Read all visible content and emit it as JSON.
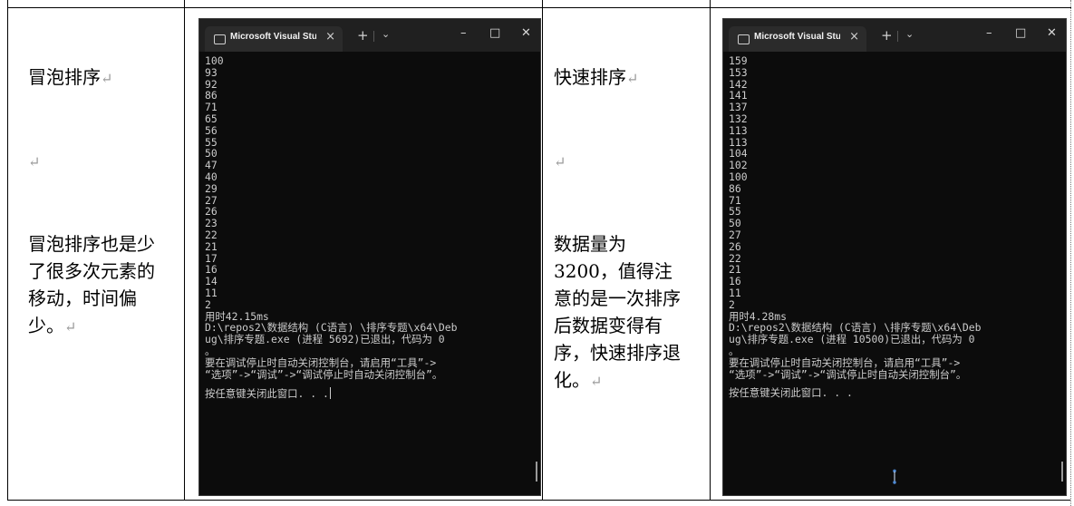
{
  "left_column": {
    "heading": "冒泡排序",
    "empty_line": "",
    "note": "冒泡排序也是少了很多次元素的移动，时间偏少。",
    "para_mark": "↵"
  },
  "right_column": {
    "heading": "快速排序",
    "empty_line": "",
    "note": "数据量为3200，值得注意的是一次排序后数据变得有序，快速排序退化。",
    "para_mark": "↵"
  },
  "window_left": {
    "tab_title": "Microsoft Visual Studio",
    "tab_close": "×",
    "new_tab": "+",
    "dropdown": "⌄",
    "minimize": "–",
    "maximize": "□",
    "close": "✕",
    "output_lines": [
      "100",
      "93",
      "92",
      "86",
      "71",
      "65",
      "56",
      "55",
      "50",
      "47",
      "40",
      "29",
      "27",
      "26",
      "23",
      "22",
      "21",
      "17",
      "16",
      "14",
      "11",
      "2"
    ],
    "elapsed": "用时42.15ms",
    "exit_message": "D:\\repos2\\数据结构 (C语言) \\排序专题\\x64\\Deb\nug\\排序专题.exe (进程 5692)已退出，代码为 0\n。",
    "hint": "要在调试停止时自动关闭控制台，请启用“工具”->\n“选项”->“调试”->“调试停止时自动关闭控制台”。",
    "press_key": "按任意键关闭此窗口. . ."
  },
  "window_right": {
    "tab_title": "Microsoft Visual Studio",
    "tab_close": "×",
    "new_tab": "+",
    "dropdown": "⌄",
    "minimize": "–",
    "maximize": "□",
    "close": "✕",
    "output_lines": [
      "159",
      "153",
      "142",
      "141",
      "137",
      "132",
      "113",
      "113",
      "104",
      "102",
      "100",
      "86",
      "71",
      "55",
      "50",
      "27",
      "26",
      "22",
      "21",
      "16",
      "11",
      "2"
    ],
    "elapsed": "用时4.28ms",
    "exit_message": "D:\\repos2\\数据结构 (C语言) \\排序专题\\x64\\Deb\nug\\排序专题.exe (进程 10500)已退出，代码为 0\n。",
    "hint": "要在调试停止时自动关闭控制台，请启用“工具”->\n“选项”->“调试”->“调试停止时自动关闭控制台”。",
    "press_key": "按任意键关闭此窗口. . ."
  }
}
